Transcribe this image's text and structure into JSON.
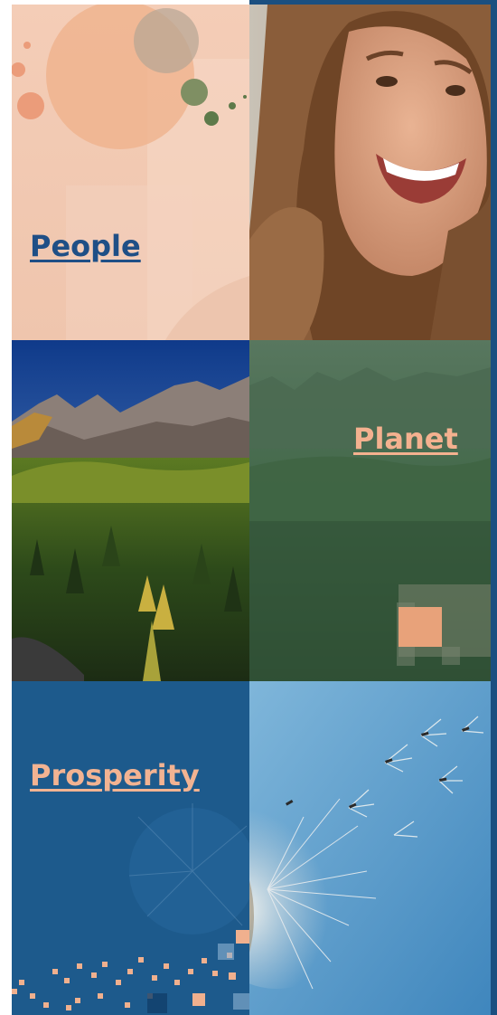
{
  "tiles": {
    "people": {
      "label": "People"
    },
    "planet": {
      "label": "Planet"
    },
    "prosperity": {
      "label": "Prosperity"
    }
  },
  "colors": {
    "people_bg": "#f2c8b1",
    "people_label": "#1f4f86",
    "planet_label": "#f4b18f",
    "prosperity_bg": "#1d5a8c",
    "prosperity_label": "#f2b392",
    "accent_square": "#e8a27a",
    "frame_blue": "#1a4f80"
  },
  "images": {
    "woman": "smiling-woman-photo",
    "mountains": "mountain-forest-photo",
    "planet_bg": "green-tinted-forest-photo",
    "dandelion": "dandelion-seeds-photo"
  }
}
